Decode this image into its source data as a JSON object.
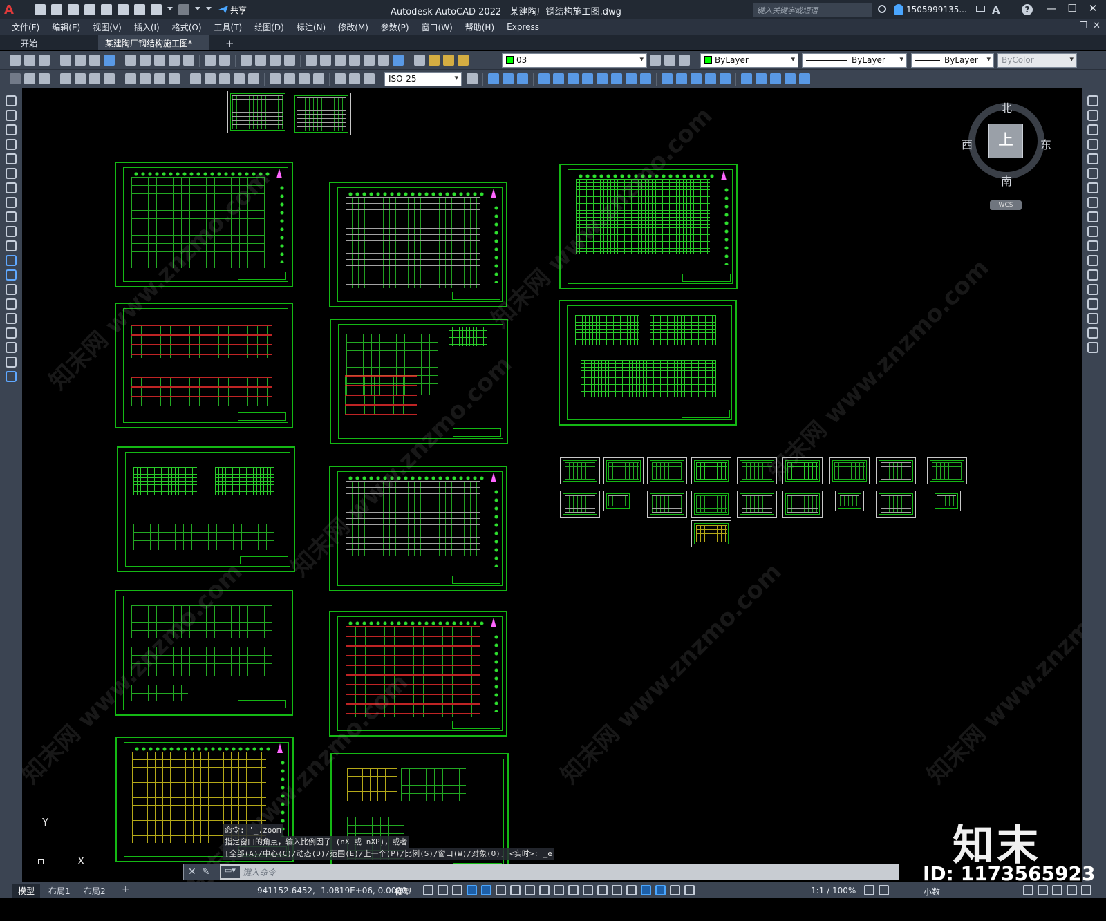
{
  "titlebar": {
    "app_title": "Autodesk AutoCAD 2022",
    "file_name": "某建陶厂钢结构施工图.dwg",
    "share_label": "共享",
    "search_placeholder": "键入关键字或短语",
    "user_name": "1505999135...",
    "window_controls": [
      "—",
      "☐",
      "✕"
    ]
  },
  "menubar": {
    "items": [
      "文件(F)",
      "编辑(E)",
      "视图(V)",
      "插入(I)",
      "格式(O)",
      "工具(T)",
      "绘图(D)",
      "标注(N)",
      "修改(M)",
      "参数(P)",
      "窗口(W)",
      "帮助(H)",
      "Express"
    ]
  },
  "filetabs": {
    "start": "开始",
    "active": "某建陶厂钢结构施工图*",
    "close_glyph": "✕",
    "add_glyph": "+"
  },
  "toolbar1": {
    "layer_value": "03",
    "layer_color": "#00ff00",
    "color_value": "ByLayer",
    "linetype_value": "ByLayer",
    "lineweight_value": "ByLayer",
    "plotstyle_value": "ByColor"
  },
  "toolbar2": {
    "dimstyle_value": "ISO-25"
  },
  "viewcube": {
    "north": "北",
    "south": "南",
    "east": "东",
    "west": "西",
    "face": "上",
    "wcs": "WCS"
  },
  "ucs": {
    "x": "X",
    "y": "Y"
  },
  "command": {
    "history": [
      "命令: '_.zoom",
      "指定窗口的角点，输入比例因子 (nX 或 nXP)，或者",
      "[全部(A)/中心(C)/动态(D)/范围(E)/上一个(P)/比例(S)/窗口(W)/对象(O)] <实时>: _e"
    ],
    "placeholder": "键入命令"
  },
  "statusbar": {
    "tabs": [
      "模型",
      "布局1",
      "布局2"
    ],
    "add_tab": "+",
    "coordinates": "941152.6452, -1.0819E+06, 0.0000",
    "space": "模型",
    "scale": "1:1 / 100%",
    "units": "小数"
  },
  "watermark": {
    "text": "知末网 www.znzmo.com",
    "brand": "知末",
    "id": "ID: 1173565923"
  },
  "colors": {
    "sheet_border": "#14b814",
    "canvas": "#000000",
    "ui_dark": "#3b4452",
    "accent": "#4aa6ff"
  }
}
